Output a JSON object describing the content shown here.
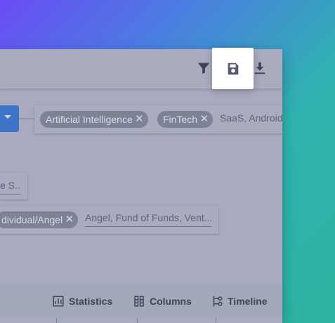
{
  "toolbar": {
    "icons": [
      "filter-icon",
      "save-icon",
      "download-icon"
    ]
  },
  "filters": {
    "industry_chips": [
      "Artificial Intelligence",
      "FinTech"
    ],
    "industry_input_value": "SaaS, Android,",
    "truncated_input_value": "e S...",
    "investor_type_chip": "dividual/Angel",
    "investor_type_input_value": "Angel, Fund of Funds, Vent..."
  },
  "chip_close_glyph": "✕",
  "bottom_bar": {
    "statistics_label": "Statistics",
    "columns_label": "Columns",
    "timeline_label": "Timeline"
  },
  "colors": {
    "accent_blue": "#3f73c8",
    "overlay_panel": "#a7aac0",
    "icon_dark": "#3f4356"
  }
}
